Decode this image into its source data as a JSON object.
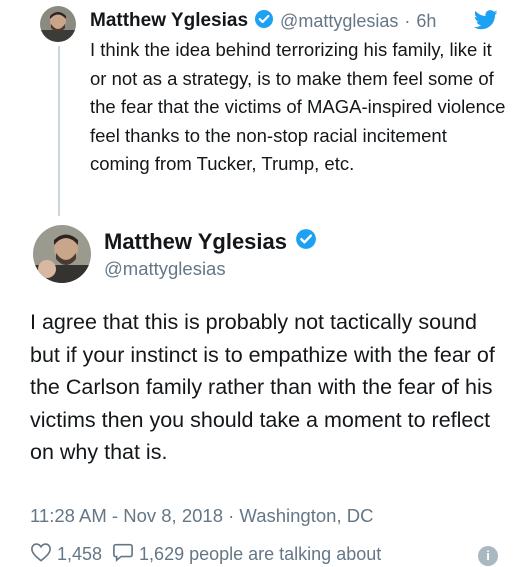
{
  "reply_tweet": {
    "author_name": "Matthew Yglesias",
    "handle": "@mattyglesias",
    "separator": "·",
    "time": "6h",
    "text": "I think the idea behind terrorizing his family, like it or not as a strategy, is to make them feel some of the fear that the victims of MAGA-inspired violence feel thanks to the non-stop racial incitement coming from Tucker, Trump, etc."
  },
  "main_tweet": {
    "author_name": "Matthew Yglesias",
    "handle": "@mattyglesias",
    "text": "I agree that this is probably not tactically sound but if your instinct is to empathize with the fear of the Carlson family rather than with the fear of his victims then you should take a moment to reflect on why that is.",
    "timestamp": "11:28 AM - Nov 8, 2018 · Washington, DC",
    "like_count": "1,458",
    "talking_text": "1,629 people are talking about"
  },
  "colors": {
    "verified": "#1da1f2",
    "twitter_blue": "#1da1f2",
    "muted": "#657786",
    "text": "#14171a"
  },
  "icons": [
    "verified-badge-icon",
    "twitter-bird-icon",
    "heart-icon",
    "comment-icon",
    "info-icon"
  ]
}
